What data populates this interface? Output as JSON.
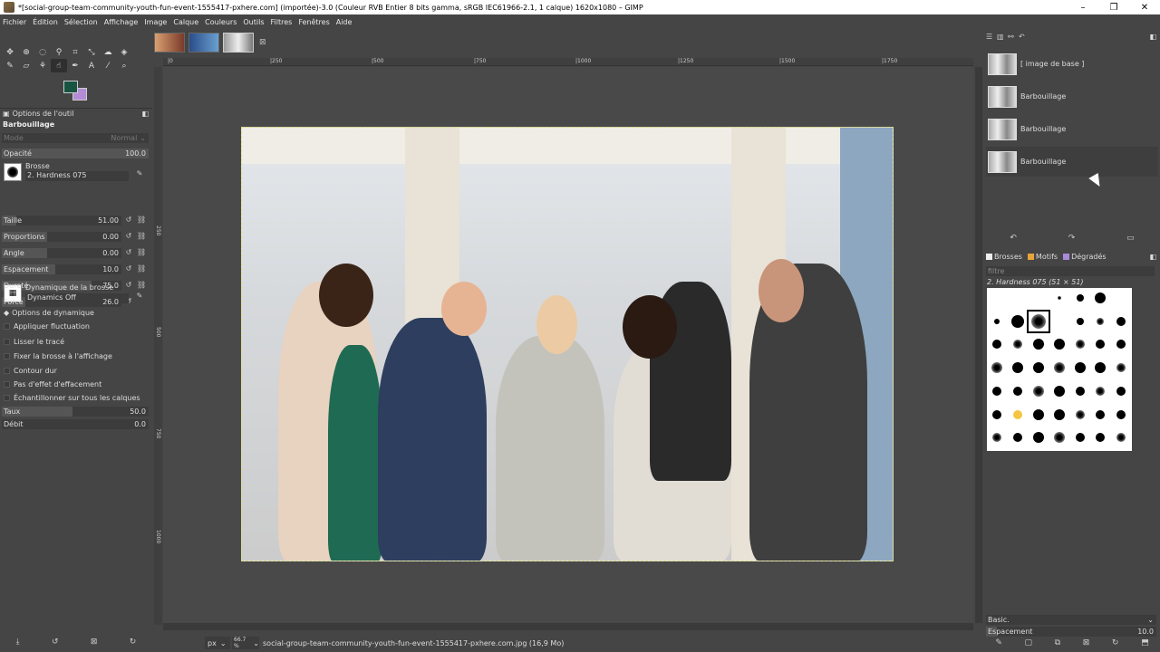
{
  "window": {
    "title": "*[social-group-team-community-youth-fun-event-1555417-pxhere.com] (importée)-3.0 (Couleur RVB Entier 8 bits gamma, sRGB IEC61966-2.1, 1 calque) 1620x1080 – GIMP",
    "minimize": "–",
    "maximize": "❐",
    "close": "✕"
  },
  "menu": [
    "Fichier",
    "Édition",
    "Sélection",
    "Affichage",
    "Image",
    "Calque",
    "Couleurs",
    "Outils",
    "Filtres",
    "Fenêtres",
    "Aide"
  ],
  "colors": {
    "foreground": "#175442",
    "background": "#b48cd6"
  },
  "tool_options": {
    "header": "Options de l'outil",
    "tool_name": "Barbouillage",
    "mode_label": "Mode",
    "mode_value": "Normal",
    "opacity_label": "Opacité",
    "opacity_value": "100.0",
    "brush_label": "Brosse",
    "brush_value": "2. Hardness 075",
    "params": [
      {
        "label": "Taille",
        "value": "51.00",
        "fill": 0.12
      },
      {
        "label": "Proportions",
        "value": "0.00",
        "fill": 0.38
      },
      {
        "label": "Angle",
        "value": "0.00",
        "fill": 0.38
      },
      {
        "label": "Espacement",
        "value": "10.0",
        "fill": 0.45
      },
      {
        "label": "Dureté",
        "value": "75.0",
        "fill": 0.75
      },
      {
        "label": "Force",
        "value": "26.0",
        "fill": 0.2
      }
    ],
    "dynamics_label": "Dynamique de la brosse",
    "dynamics_value": "Dynamics Off",
    "dynamics_options": "Options de dynamique",
    "checks": [
      "Appliquer fluctuation",
      "Lisser le tracé",
      "Fixer la brosse à l'affichage",
      "Contour dur",
      "Pas d'effet d'effacement",
      "Échantillonner sur tous les calques"
    ],
    "rate_label": "Taux",
    "rate_value": "50.0",
    "flow_label": "Débit",
    "flow_value": "0.0"
  },
  "ruler": {
    "ticks": [
      "|0",
      "|250",
      "|500",
      "|750",
      "|1000",
      "|1250",
      "|1500",
      "|1750"
    ]
  },
  "vruler": {
    "ticks": [
      "250",
      "500",
      "750",
      "1000"
    ]
  },
  "status": {
    "unit": "px",
    "zoom": "66.7 %",
    "file": "social-group-team-community-youth-fun-event-1555417-pxhere.com.jpg (16,9 Mo)"
  },
  "layers": [
    {
      "name": "[ image de base ]",
      "selected": false
    },
    {
      "name": "Barbouillage",
      "selected": false
    },
    {
      "name": "Barbouillage",
      "selected": false
    },
    {
      "name": "Barbouillage",
      "selected": true
    }
  ],
  "brushes": {
    "tabs": [
      {
        "label": "Brosses",
        "color": "#eee"
      },
      {
        "label": "Motifs",
        "color": "#e8a43a"
      },
      {
        "label": "Dégradés",
        "color": "#a98ad8"
      }
    ],
    "filter_placeholder": "filtre",
    "current": "2. Hardness 075 (51 × 51)",
    "preset": "Basic.",
    "spacing_label": "Espacement",
    "spacing_value": "10.0"
  }
}
